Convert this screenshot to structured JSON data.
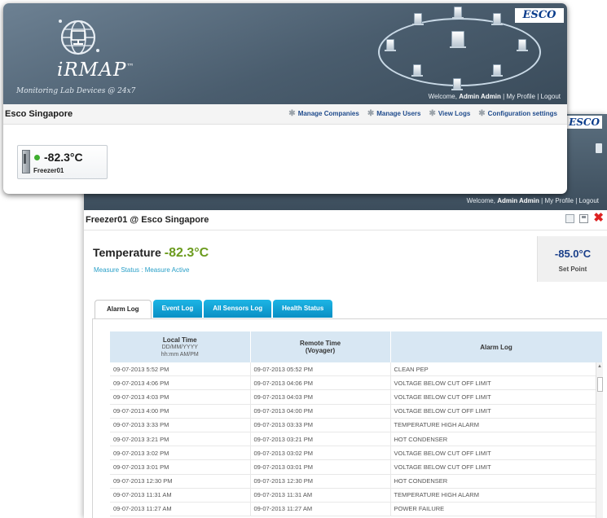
{
  "dashboard": {
    "brand": {
      "name": "iRMAP",
      "trademark": "™",
      "tagline": "Monitoring Lab Devices @ 24x7"
    },
    "vendor_badge": "ESCO",
    "welcome": {
      "prefix": "Welcome, ",
      "user": "Admin Admin",
      "my_profile": "My Profile",
      "logout": "Logout",
      "separator": " | "
    },
    "company": "Esco Singapore",
    "nav": [
      {
        "label": "Manage Companies",
        "icon": "gear-icon"
      },
      {
        "label": "Manage Users",
        "icon": "gear-icon"
      },
      {
        "label": "View Logs",
        "icon": "gear-icon"
      },
      {
        "label": "Configuration settings",
        "icon": "gear-icon"
      }
    ],
    "device": {
      "temperature": "-82.3°C",
      "name": "Freezer01",
      "status_color": "#3fae2f"
    }
  },
  "detail": {
    "vendor_badge": "ESCO",
    "welcome": {
      "prefix": "Welcome, ",
      "user": "Admin Admin",
      "my_profile": "My Profile",
      "logout": "Logout",
      "separator": " | "
    },
    "title": "Freezer01 @ Esco Singapore",
    "temperature_label": "Temperature",
    "temperature_value": "-82.3°C",
    "measure_status": "Measure Status : Measure Active",
    "set_point": {
      "value": "-85.0°C",
      "label": "Set Point"
    },
    "tabs": [
      {
        "label": "Alarm Log",
        "active": true
      },
      {
        "label": "Event Log",
        "active": false
      },
      {
        "label": "All Sensors Log",
        "active": false
      },
      {
        "label": "Health Status",
        "active": false
      }
    ],
    "table": {
      "headers": {
        "local_time": "Local Time",
        "local_time_format": "DD/MM/YYYY",
        "local_time_format2": "hh:mm AM/PM",
        "remote_time": "Remote Time",
        "remote_time_sub": "(Voyager)",
        "alarm_log": "Alarm Log"
      },
      "rows": [
        [
          "09-07-2013 5:52 PM",
          "09-07-2013 05:52 PM",
          "CLEAN PEP"
        ],
        [
          "09-07-2013 4:06 PM",
          "09-07-2013 04:06 PM",
          "VOLTAGE BELOW CUT OFF LIMIT"
        ],
        [
          "09-07-2013 4:03 PM",
          "09-07-2013 04:03 PM",
          "VOLTAGE BELOW CUT OFF LIMIT"
        ],
        [
          "09-07-2013 4:00 PM",
          "09-07-2013 04:00 PM",
          "VOLTAGE BELOW CUT OFF LIMIT"
        ],
        [
          "09-07-2013 3:33 PM",
          "09-07-2013 03:33 PM",
          "TEMPERATURE HIGH ALARM"
        ],
        [
          "09-07-2013 3:21 PM",
          "09-07-2013 03:21 PM",
          "HOT CONDENSER"
        ],
        [
          "09-07-2013 3:02 PM",
          "09-07-2013 03:02 PM",
          "VOLTAGE BELOW CUT OFF LIMIT"
        ],
        [
          "09-07-2013 3:01 PM",
          "09-07-2013 03:01 PM",
          "VOLTAGE BELOW CUT OFF LIMIT"
        ],
        [
          "09-07-2013 12:30 PM",
          "09-07-2013 12:30 PM",
          "HOT CONDENSER"
        ],
        [
          "09-07-2013 11:31 AM",
          "09-07-2013 11:31 AM",
          "TEMPERATURE HIGH ALARM"
        ],
        [
          "09-07-2013 11:27 AM",
          "09-07-2013 11:27 AM",
          "POWER FAILURE"
        ]
      ]
    }
  },
  "colors": {
    "header_bg": "#4a5d6e",
    "temperature_green": "#6b9b1e",
    "setpoint_blue": "#1a3f8a",
    "tab_blue": "#0a8fc4",
    "nav_link": "#1f4b8c",
    "close_red": "#dd2222"
  }
}
